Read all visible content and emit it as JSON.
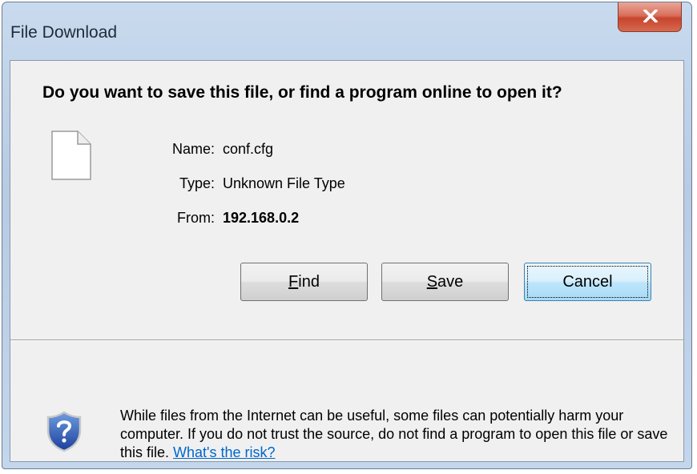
{
  "window": {
    "title": "File Download"
  },
  "icons": {
    "close": "close-icon",
    "file": "generic-file-icon",
    "shield": "shield-question-icon"
  },
  "dialog": {
    "question": "Do you want to save this file, or find a program online to open it?",
    "file": {
      "name_label": "Name:",
      "name_value": "conf.cfg",
      "type_label": "Type:",
      "type_value": "Unknown File Type",
      "from_label": "From:",
      "from_value": "192.168.0.2"
    },
    "buttons": {
      "find": {
        "accel": "F",
        "rest": "ind"
      },
      "save": {
        "accel": "S",
        "rest": "ave"
      },
      "cancel": "Cancel"
    },
    "warning": {
      "text": "While files from the Internet can be useful, some files can potentially harm your computer. If you do not trust the source, do not find a program to open this file or save this file.",
      "link": "What's the risk?"
    }
  },
  "colors": {
    "titlebar": "#c9daee",
    "close_button": "#c7452d",
    "client_bg": "#f0f0f0",
    "default_button_border": "#3c7fb1",
    "link": "#0066cc"
  }
}
